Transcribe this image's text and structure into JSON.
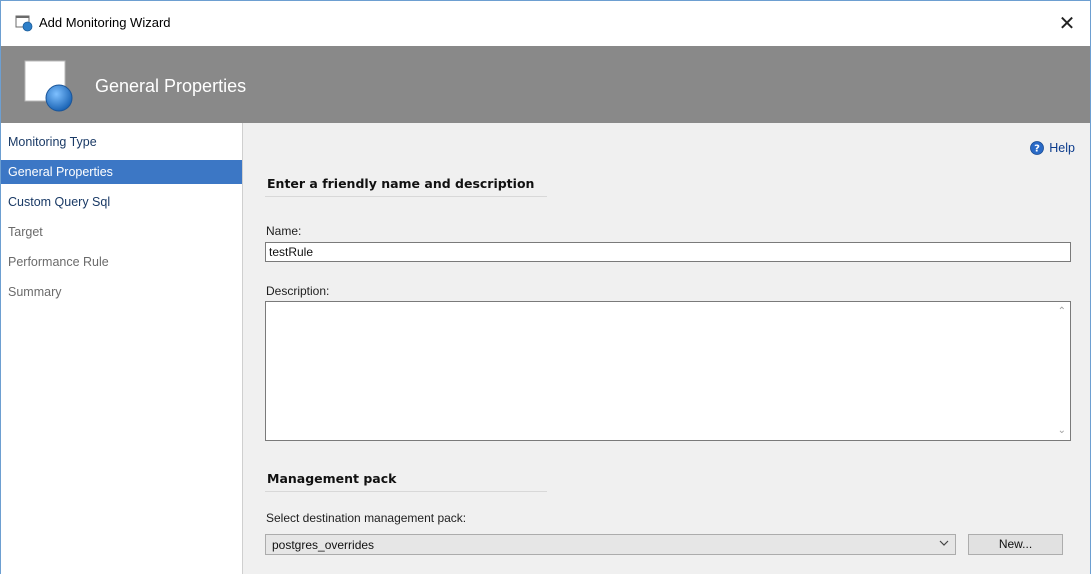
{
  "window": {
    "title": "Add Monitoring Wizard",
    "close_glyph": "✕"
  },
  "banner": {
    "title": "General Properties"
  },
  "sidebar": {
    "items": [
      {
        "label": "Monitoring Type",
        "state": "enabled"
      },
      {
        "label": "General Properties",
        "state": "selected"
      },
      {
        "label": "Custom Query Sql",
        "state": "enabled"
      },
      {
        "label": "Target",
        "state": "disabled"
      },
      {
        "label": "Performance Rule",
        "state": "disabled"
      },
      {
        "label": "Summary",
        "state": "disabled"
      }
    ]
  },
  "help": {
    "label": "Help"
  },
  "section_name": {
    "title": "Enter a friendly name and description",
    "name_label": "Name:",
    "name_value": "testRule",
    "description_label": "Description:",
    "description_value": ""
  },
  "section_pack": {
    "title": "Management pack",
    "select_label": "Select destination management pack:",
    "selected_pack": "postgres_overrides",
    "new_button": "New..."
  },
  "colors": {
    "banner": "#898989",
    "selected_nav": "#3c77c5",
    "content_bg": "#f0f0f0"
  }
}
